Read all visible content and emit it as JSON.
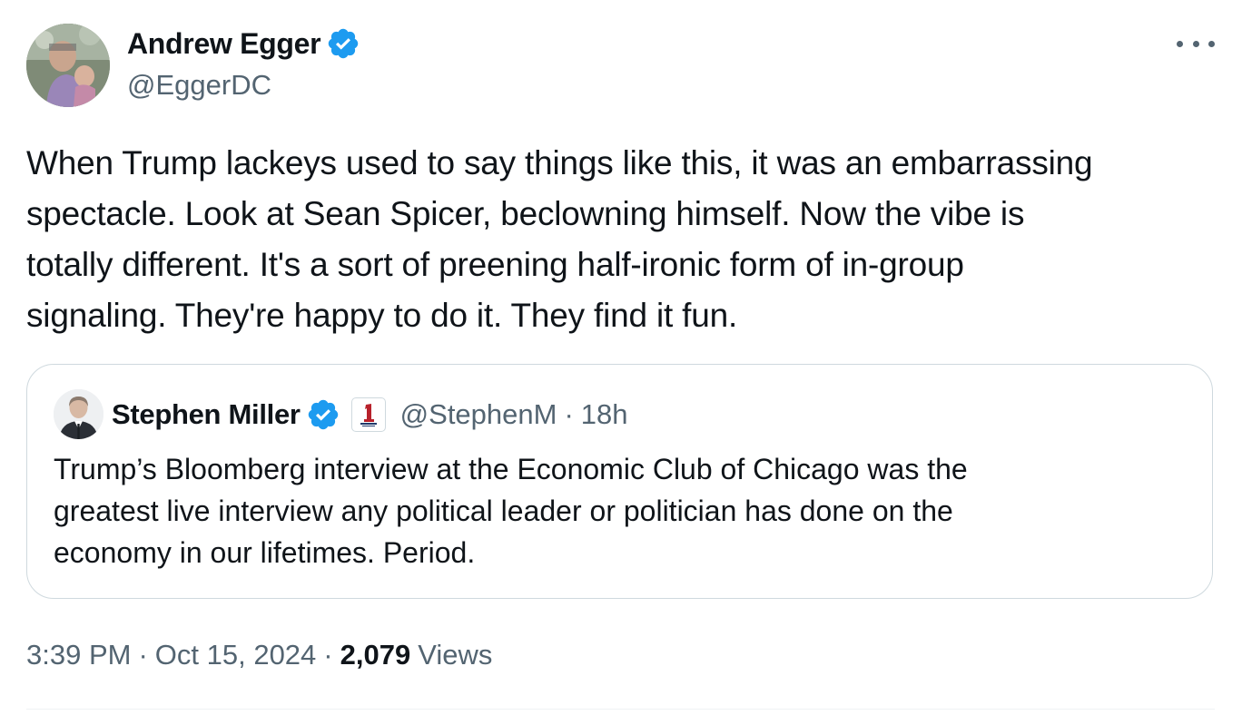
{
  "author": {
    "display_name": "Andrew Egger",
    "handle": "@EggerDC"
  },
  "tweet_text": "When Trump lackeys used to say things like this, it was an embarrassing\nspectacle. Look at Sean Spicer, beclowning himself. Now the vibe is\ntotally different. It's a sort of preening half-ironic form of in-group\nsignaling. They're happy to do it. They find it fun.",
  "quoted_tweet": {
    "display_name": "Stephen Miller",
    "handle": "@StephenM",
    "separator": "·",
    "time_ago": "18h",
    "text": "Trump’s Bloomberg interview at the Economic Club of Chicago was the\ngreatest live interview any political leader or politician has done on the\neconomy in our lifetimes. Period."
  },
  "meta": {
    "time": "3:39 PM",
    "separator": "·",
    "date": "Oct 15, 2024",
    "views_count": "2,079",
    "views_label": "Views"
  },
  "colors": {
    "verified": "#1d9bf0",
    "secondary_text": "#536471",
    "border": "#cfd9de"
  },
  "icons": [
    "verified-badge-icon",
    "more-options-icon",
    "affiliation-badge-icon"
  ]
}
